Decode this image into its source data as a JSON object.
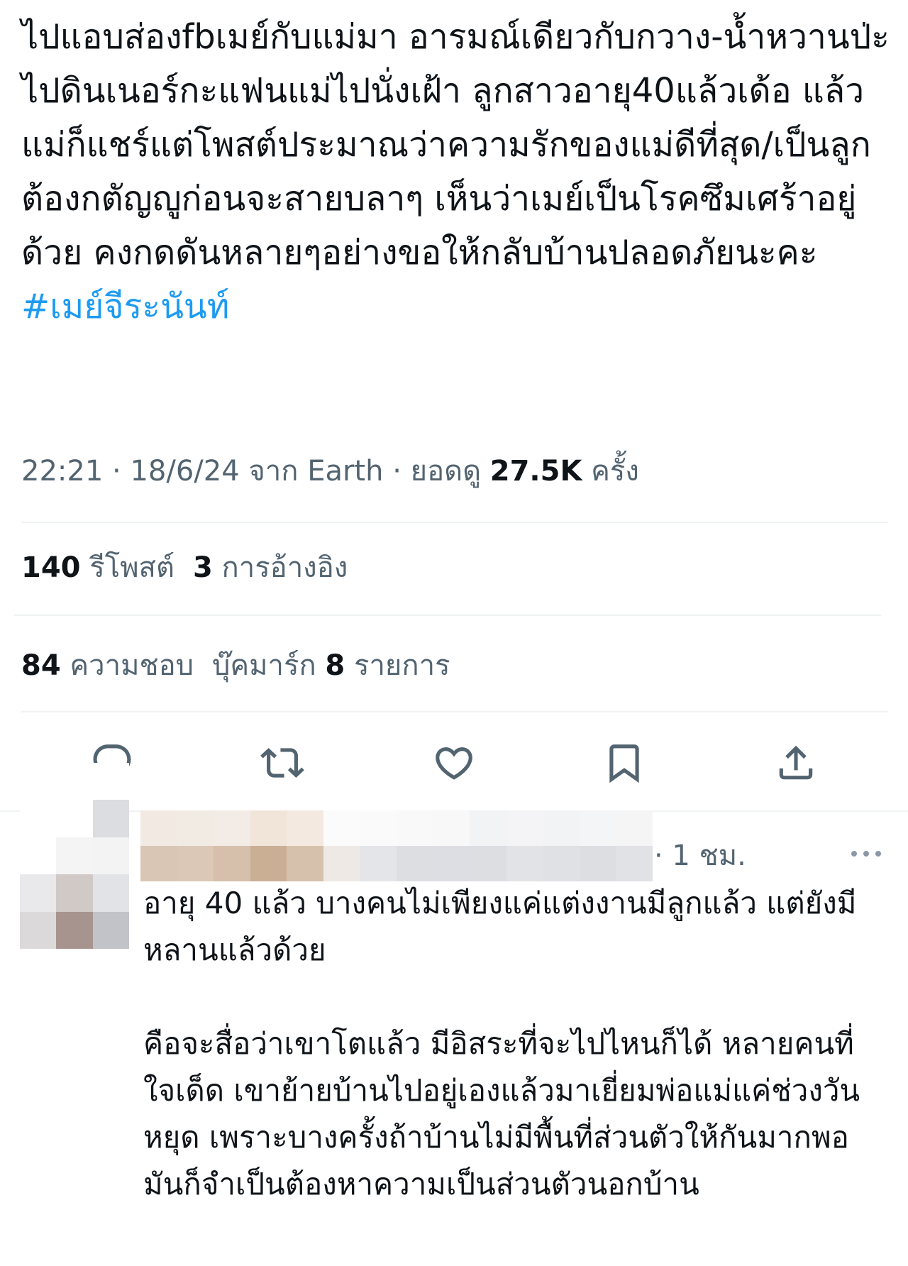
{
  "tweet": {
    "text": "ไปแอบส่องfbเมย์กับแม่มา อารมณ์เดียวกับกวาง-น้ำหวานป่ะ ไปดินเนอร์กะแฟนแม่ไปนั่งเฝ้า ลูกสาวอายุ40แล้วเด้อ แล้วแม่ก็แชร์แต่โพสต์ประมาณว่าความรักของแม่ดีที่สุด/เป็นลูกต้องกตัญญูก่อนจะสายบลาๆ เห็นว่าเมย์เป็นโรคซึมเศร้าอยู่ด้วย คงกดดันหลายๆอย่างขอให้กลับบ้านปลอดภัยนะคะ ",
    "hashtag": "#เมย์จีระนันท์",
    "time": "22:21",
    "date": "18/6/24",
    "source_prefix": "จาก",
    "source": "Earth",
    "views_prefix": "ยอดดู",
    "views": "27.5K",
    "views_suffix": "ครั้ง",
    "separator": "·"
  },
  "stats": {
    "reposts_count": "140",
    "reposts_label": "รีโพสต์",
    "quotes_count": "3",
    "quotes_label": "การอ้างอิง",
    "likes_count": "84",
    "likes_label": "ความชอบ",
    "bookmarks_prefix": "บุ๊คมาร์ก",
    "bookmarks_count": "8",
    "bookmarks_suffix": "รายการ"
  },
  "actions": {
    "icons": [
      "reply-icon",
      "repost-icon",
      "like-icon",
      "bookmark-icon",
      "share-icon"
    ],
    "icon_color": "#536471"
  },
  "reply": {
    "time": "· 1 ชม.",
    "paragraph1": "อายุ 40 แล้ว บางคนไม่เพียงแค่แต่งงานมีลูกแล้ว แต่ยังมีหลานแล้วด้วย",
    "paragraph2": "คือจะสื่อว่าเขาโตแล้ว มีอิสระที่จะไปไหนก็ได้ หลายคนที่ใจเด็ด เขาย้ายบ้านไปอยู่เองแล้วมาเยี่ยมพ่อแม่แค่ช่วงวันหยุด เพราะบางครั้งถ้าบ้านไม่มีพื้นที่ส่วนตัวให้กันมากพอ มันก็จำเป็นต้องหาความเป็นส่วนตัวนอกบ้าน",
    "avatar_pixels": [
      "#ffffff",
      "#ffffff",
      "#ffffff",
      "#ffffff",
      "#ffffff",
      "#dcdde0",
      "#ffffff",
      "#f4f4f5",
      "#f3f3f4",
      "#e9e9eb",
      "#d1c9c6",
      "#e2e3e6",
      "#dcd9da",
      "#a8948f",
      "#c2c3c8",
      "#f1f0f0",
      "#a9a6a6",
      "#d3d2d6"
    ],
    "name_pixels": [
      "#f1e9e2",
      "#f2ebe4",
      "#f3ece6",
      "#f1e5da",
      "#f3e9e0",
      "#fbfbfb",
      "#fafafa",
      "#f9f9f9",
      "#f8f8f9",
      "#f2f3f5",
      "#f4f4f6",
      "#f2f3f5",
      "#f4f5f6",
      "#f5f5f6",
      "#d9c6b4",
      "#dbc8b6",
      "#d6c0ab",
      "#caaf95",
      "#d6c1ac",
      "#eee9e4",
      "#e4e5e8",
      "#dcdee2",
      "#dcdee3",
      "#dcdee2",
      "#e2e3e7",
      "#dfe1e5",
      "#dcdee2",
      "#e1e2e6"
    ],
    "more_icon": "more-horizontal-icon"
  },
  "colors": {
    "text": "#0f1419",
    "secondary": "#536471",
    "link": "#1d9bf0",
    "divider": "#eff3f4"
  }
}
